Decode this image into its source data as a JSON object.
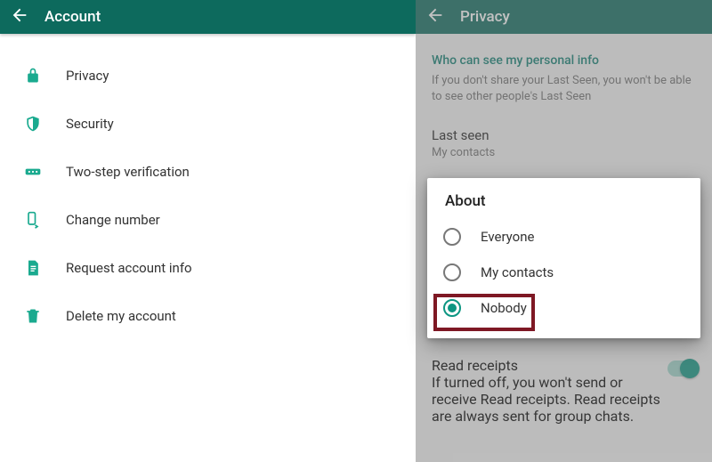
{
  "left": {
    "header": {
      "title": "Account"
    },
    "items": [
      {
        "label": "Privacy"
      },
      {
        "label": "Security"
      },
      {
        "label": "Two-step verification"
      },
      {
        "label": "Change number"
      },
      {
        "label": "Request account info"
      },
      {
        "label": "Delete my account"
      }
    ]
  },
  "right": {
    "header": {
      "title": "Privacy"
    },
    "section_heading": "Who can see my personal info",
    "section_sub": "If you don't share your Last Seen, you won't be able to see other people's Last Seen",
    "last_seen": {
      "title": "Last seen",
      "value": "My contacts"
    },
    "read_receipts": {
      "title": "Read receipts",
      "sub": "If turned off, you won't send or receive Read receipts. Read receipts are always sent for group chats.",
      "enabled": true
    },
    "dialog": {
      "title": "About",
      "options": [
        {
          "label": "Everyone",
          "selected": false
        },
        {
          "label": "My contacts",
          "selected": false
        },
        {
          "label": "Nobody",
          "selected": true
        }
      ]
    }
  }
}
